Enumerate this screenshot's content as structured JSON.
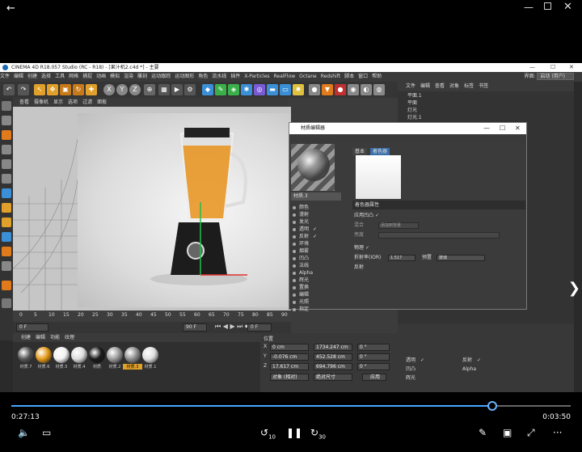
{
  "player": {
    "back_glyph": "←",
    "window": {
      "min": "—",
      "max": "",
      "close": "✕"
    },
    "time_current": "0:27:13",
    "time_remaining": "0:03:50",
    "progress": 0.86,
    "skip_back": "10",
    "skip_forward": "30",
    "next_glyph": "❯",
    "colors": {
      "accent": "#4aa3ff"
    }
  },
  "c4d": {
    "title": "CINEMA 4D R18.057 Studio (RC - R18) - [果汁机2.c4d *] - 主要",
    "menu": [
      "文件",
      "编辑",
      "创建",
      "选择",
      "工具",
      "网格",
      "捕捉",
      "动画",
      "模拟",
      "渲染",
      "雕刻",
      "运动跟踪",
      "运动图形",
      "角色",
      "流水线",
      "插件",
      "X-Particles",
      "RealFlow",
      "Octane",
      "Redshift",
      "脚本",
      "窗口",
      "帮助"
    ],
    "layout_label": "界面:",
    "layout_value": "启动 (用户)",
    "toolbar_letters": [
      "X",
      "Y",
      "Z"
    ],
    "viewport_menu": [
      "查看",
      "摄像机",
      "显示",
      "选项",
      "过滤",
      "面板"
    ],
    "timeline_ticks": [
      "0",
      "5",
      "10",
      "15",
      "20",
      "25",
      "30",
      "35",
      "40",
      "45",
      "50",
      "55",
      "60",
      "65",
      "70",
      "75",
      "80",
      "85",
      "90"
    ],
    "frame_start": "0 F",
    "frame_end": "90 F",
    "frame_current": "0 F",
    "material_menu": [
      "创建",
      "编辑",
      "功能",
      "纹理"
    ],
    "materials": [
      {
        "name": "材质.7",
        "color": "#555"
      },
      {
        "name": "材质.6",
        "color": "#e49a1a"
      },
      {
        "name": "材质.5",
        "color": "#f2f2f2"
      },
      {
        "name": "材质.4",
        "color": "#dcdcdc"
      },
      {
        "name": "材质",
        "color": "#1a1a1a"
      },
      {
        "name": "材质.2",
        "color": "#9a9a9a"
      },
      {
        "name": "材质.3",
        "color": "#8d8d8d",
        "selected": true
      },
      {
        "name": "材质.1",
        "color": "#e0e0e0"
      }
    ],
    "coords": {
      "header": "位置",
      "x_pos": "0 cm",
      "y_pos": "-0.076 cm",
      "z_pos": "17.617 cm",
      "x_size": "1734.247 cm",
      "y_size": "452.528 cm",
      "z_size": "694.796 cm",
      "h_rot": "0 °",
      "p_rot": "0 °",
      "b_rot": "0 °",
      "mode": "对象 (相对)",
      "size_mode": "绝对尺寸",
      "apply": "应用"
    },
    "status_left": "00:00:00  正在渲染",
    "status_right": "分辨率 120 x 120",
    "objects_menu": [
      "文件",
      "编辑",
      "查看",
      "对象",
      "标签",
      "书签"
    ],
    "objects": [
      "平面.1",
      "平面",
      "灯光",
      "灯光.1"
    ],
    "attr_rows": [
      {
        "label": "透明",
        "state": "✓"
      },
      {
        "label": "反射",
        "state": "✓"
      },
      {
        "label": "凹凸",
        "state": ""
      },
      {
        "label": "Alpha",
        "state": ""
      },
      {
        "label": "辉光",
        "state": ""
      }
    ]
  },
  "material_editor": {
    "title": "材质编辑器",
    "material_name": "材质.3",
    "tabs": [
      "基本",
      "着色器"
    ],
    "channels": [
      {
        "label": "颜色",
        "checked": ""
      },
      {
        "label": "漫射",
        "checked": ""
      },
      {
        "label": "发光",
        "checked": ""
      },
      {
        "label": "透明",
        "checked": "✓"
      },
      {
        "label": "反射",
        "checked": "✓"
      },
      {
        "label": "环境",
        "checked": ""
      },
      {
        "label": "烟雾",
        "checked": ""
      },
      {
        "label": "凹凸",
        "checked": ""
      },
      {
        "label": "法线",
        "checked": ""
      },
      {
        "label": "Alpha",
        "checked": ""
      },
      {
        "label": "辉光",
        "checked": ""
      },
      {
        "label": "置换",
        "checked": ""
      },
      {
        "label": "编辑",
        "checked": ""
      },
      {
        "label": "光照",
        "checked": ""
      },
      {
        "label": "指定",
        "checked": ""
      }
    ],
    "section_title": "着色器属性",
    "rows": {
      "use_bump": "应用凹凸",
      "mix": "混合",
      "mix_value": "添加到背景",
      "brightness": "亮度",
      "density": "物理",
      "ior_label": "折射率(IOR)",
      "ior_value": "1.517",
      "preset_label": "预置",
      "preset_value": "玻璃",
      "reflect": "反射"
    }
  }
}
